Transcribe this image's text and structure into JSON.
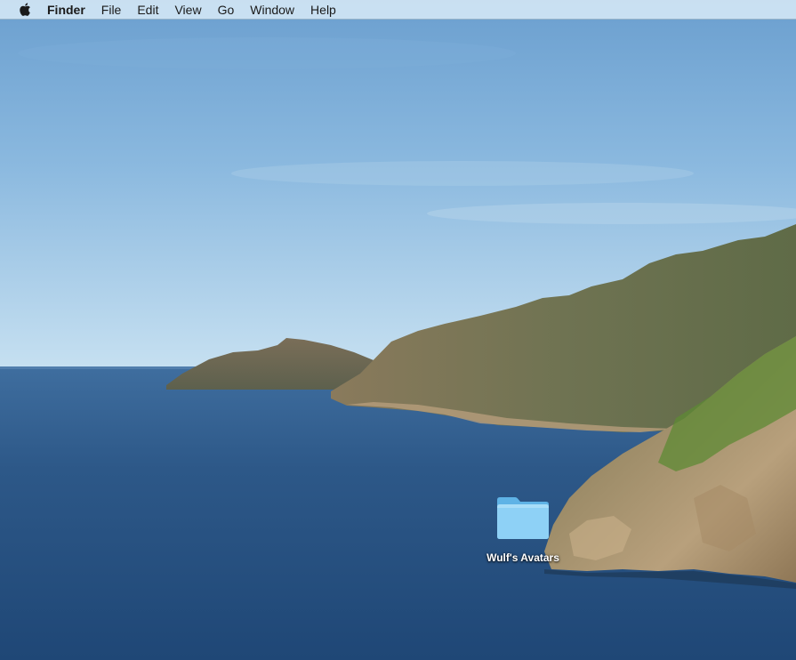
{
  "menubar": {
    "apple_icon": "apple-logo-icon",
    "app_name": "Finder",
    "items": [
      "File",
      "Edit",
      "View",
      "Go",
      "Window",
      "Help"
    ]
  },
  "desktop": {
    "folders": [
      {
        "label": "Wulf's Avatars",
        "icon": "folder-icon",
        "color": "#7cc8f2"
      }
    ]
  },
  "colors": {
    "menubar_bg": "#d6e8f6",
    "sky_top": "#6da2d1",
    "sky_horizon": "#c7e1f1",
    "sea": "#2f5a8a"
  }
}
